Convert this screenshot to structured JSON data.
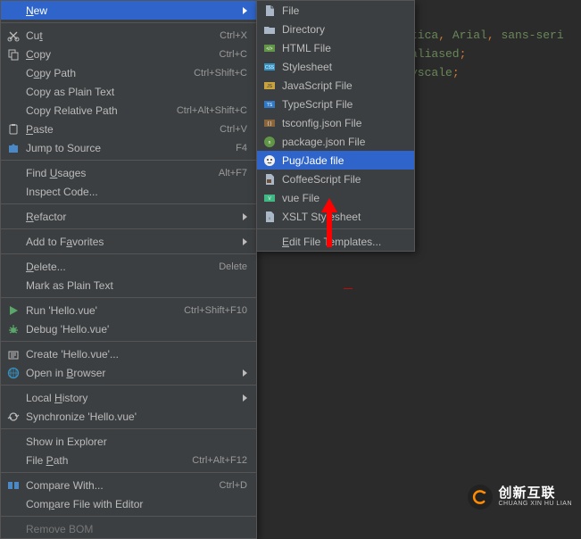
{
  "editor_code": {
    "line1_a": "tica",
    "line1_b": "Arial",
    "line1_c": "sans-seri",
    "line2": "aliased",
    "line3": "yscale",
    "comma": ", ",
    "semicolon": ";"
  },
  "main_menu": [
    {
      "id": "new",
      "label": "New",
      "shortcut": "",
      "submenu": true,
      "selected": true,
      "icon": "blank",
      "underline_index": 0
    },
    {
      "sep": true
    },
    {
      "id": "cut",
      "label": "Cut",
      "shortcut": "Ctrl+X",
      "icon": "cut",
      "underline_index": 2
    },
    {
      "id": "copy",
      "label": "Copy",
      "shortcut": "Ctrl+C",
      "icon": "copy",
      "underline_index": 0
    },
    {
      "id": "copy-path",
      "label": "Copy Path",
      "shortcut": "Ctrl+Shift+C",
      "icon": "blank",
      "underline_index": 1
    },
    {
      "id": "copy-plain",
      "label": "Copy as Plain Text",
      "shortcut": "",
      "icon": "blank"
    },
    {
      "id": "copy-rel",
      "label": "Copy Relative Path",
      "shortcut": "Ctrl+Alt+Shift+C",
      "icon": "blank"
    },
    {
      "id": "paste",
      "label": "Paste",
      "shortcut": "Ctrl+V",
      "icon": "paste",
      "underline_index": 0
    },
    {
      "id": "jump-src",
      "label": "Jump to Source",
      "shortcut": "F4",
      "icon": "jump"
    },
    {
      "sep": true
    },
    {
      "id": "find-usages",
      "label": "Find Usages",
      "shortcut": "Alt+F7",
      "icon": "blank",
      "underline_index": 5
    },
    {
      "id": "inspect",
      "label": "Inspect Code...",
      "shortcut": "",
      "icon": "blank"
    },
    {
      "sep": true
    },
    {
      "id": "refactor",
      "label": "Refactor",
      "shortcut": "",
      "submenu": true,
      "icon": "blank",
      "underline_index": 0
    },
    {
      "sep": true
    },
    {
      "id": "favorites",
      "label": "Add to Favorites",
      "shortcut": "",
      "submenu": true,
      "icon": "blank",
      "underline_index": 8
    },
    {
      "sep": true
    },
    {
      "id": "delete",
      "label": "Delete...",
      "shortcut": "Delete",
      "icon": "blank",
      "underline_index": 0
    },
    {
      "id": "mark-plain",
      "label": "Mark as Plain Text",
      "shortcut": "",
      "icon": "blank"
    },
    {
      "sep": true
    },
    {
      "id": "run",
      "label": "Run 'Hello.vue'",
      "shortcut": "Ctrl+Shift+F10",
      "icon": "run"
    },
    {
      "id": "debug",
      "label": "Debug 'Hello.vue'",
      "shortcut": "",
      "icon": "debug"
    },
    {
      "sep": true
    },
    {
      "id": "create-config",
      "label": "Create 'Hello.vue'...",
      "shortcut": "",
      "icon": "config"
    },
    {
      "id": "open-browser",
      "label": "Open in Browser",
      "shortcut": "",
      "submenu": true,
      "icon": "browser",
      "underline_index": 8
    },
    {
      "sep": true
    },
    {
      "id": "local-history",
      "label": "Local History",
      "shortcut": "",
      "submenu": true,
      "icon": "blank",
      "underline_index": 6
    },
    {
      "id": "sync",
      "label": "Synchronize 'Hello.vue'",
      "shortcut": "",
      "icon": "sync"
    },
    {
      "sep": true
    },
    {
      "id": "show-explorer",
      "label": "Show in Explorer",
      "shortcut": "",
      "icon": "blank"
    },
    {
      "id": "file-path",
      "label": "File Path",
      "shortcut": "Ctrl+Alt+F12",
      "icon": "blank",
      "underline_index": 5
    },
    {
      "sep": true
    },
    {
      "id": "compare",
      "label": "Compare With...",
      "shortcut": "Ctrl+D",
      "icon": "compare"
    },
    {
      "id": "compare-editor",
      "label": "Compare File with Editor",
      "shortcut": "",
      "icon": "blank",
      "underline_index": 3
    },
    {
      "sep": true
    },
    {
      "id": "remove-bom",
      "label": "Remove BOM",
      "shortcut": "",
      "icon": "blank",
      "disabled": true
    }
  ],
  "sub_menu": [
    {
      "id": "file",
      "label": "File",
      "icon": "file"
    },
    {
      "id": "directory",
      "label": "Directory",
      "icon": "folder"
    },
    {
      "id": "html-file",
      "label": "HTML File",
      "icon": "html"
    },
    {
      "id": "stylesheet",
      "label": "Stylesheet",
      "icon": "css"
    },
    {
      "id": "js-file",
      "label": "JavaScript File",
      "icon": "js"
    },
    {
      "id": "ts-file",
      "label": "TypeScript File",
      "icon": "ts"
    },
    {
      "id": "tsconfig",
      "label": "tsconfig.json File",
      "icon": "json"
    },
    {
      "id": "package-json",
      "label": "package.json File",
      "icon": "npm"
    },
    {
      "id": "pug",
      "label": "Pug/Jade file",
      "icon": "pug",
      "selected": true
    },
    {
      "id": "coffee",
      "label": "CoffeeScript File",
      "icon": "coffee"
    },
    {
      "id": "vue",
      "label": "vue File",
      "icon": "vue"
    },
    {
      "id": "xslt",
      "label": "XSLT Stylesheet",
      "icon": "xslt"
    },
    {
      "sep": true
    },
    {
      "id": "edit-templates",
      "label": "Edit File Templates...",
      "icon": "blank",
      "underline_index": 0
    }
  ],
  "watermark": {
    "zh": "创新互联",
    "py": "CHUANG XIN HU LIAN"
  },
  "red_mark": "—"
}
